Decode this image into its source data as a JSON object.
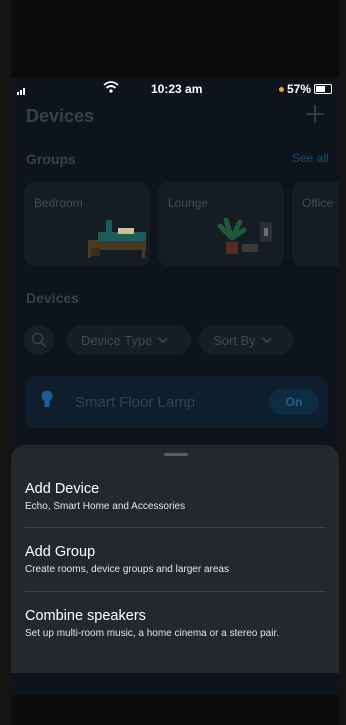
{
  "status_bar": {
    "time": "10:23 am",
    "battery": "57%"
  },
  "header": {
    "title": "Devices",
    "add_icon": "plus-icon"
  },
  "groups": {
    "heading": "Groups",
    "see_all": "See all",
    "cards": [
      {
        "label": "Bedroom"
      },
      {
        "label": "Lounge"
      },
      {
        "label": "Office"
      }
    ]
  },
  "devices": {
    "heading": "Devices",
    "filters": {
      "device_type": "Device Type",
      "sort_by": "Sort By"
    },
    "items": [
      {
        "name": "Smart Floor Lamp",
        "state": "On"
      }
    ]
  },
  "sheet": {
    "items": [
      {
        "title": "Add Device",
        "subtitle": "Echo, Smart Home and Accessories"
      },
      {
        "title": "Add Group",
        "subtitle": "Create rooms, device groups and larger areas"
      },
      {
        "title": "Combine speakers",
        "subtitle": "Set up multi-room music, a home cinema or a stereo pair."
      }
    ]
  },
  "colors": {
    "accent": "#1d4f70",
    "sheet_bg": "#23282a",
    "app_bg": "#0d141c"
  }
}
